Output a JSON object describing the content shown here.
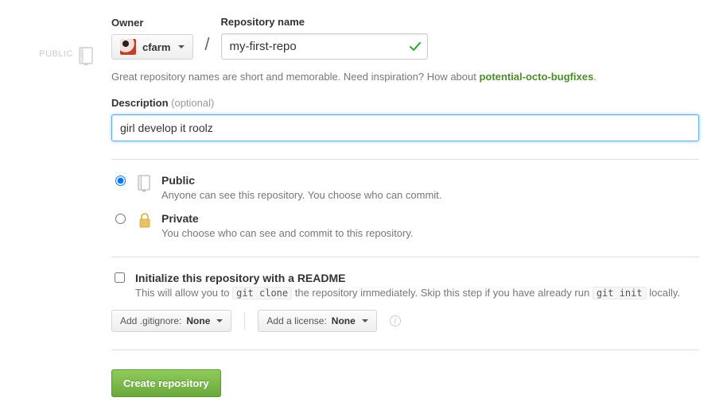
{
  "leftRail": {
    "label": "PUBLIC"
  },
  "owner": {
    "label": "Owner",
    "name": "cfarm"
  },
  "repo": {
    "label": "Repository name",
    "value": "my-first-repo"
  },
  "hint": {
    "text": "Great repository names are short and memorable. Need inspiration? How about ",
    "suggestion": "potential-octo-bugfixes",
    "end": "."
  },
  "description": {
    "label": "Description",
    "optional": "(optional)",
    "value": "girl develop it roolz"
  },
  "visibility": {
    "public": {
      "title": "Public",
      "sub": "Anyone can see this repository. You choose who can commit."
    },
    "private": {
      "title": "Private",
      "sub": "You choose who can see and commit to this repository."
    },
    "selected": "public"
  },
  "init": {
    "title": "Initialize this repository with a README",
    "sub_before": "This will allow you to ",
    "code1": "git clone",
    "sub_mid": " the repository immediately. Skip this step if you have already run ",
    "code2": "git init",
    "sub_after": " locally."
  },
  "selects": {
    "gitignore_prefix": "Add .gitignore: ",
    "gitignore_value": "None",
    "license_prefix": "Add a license: ",
    "license_value": "None"
  },
  "createButton": "Create repository"
}
